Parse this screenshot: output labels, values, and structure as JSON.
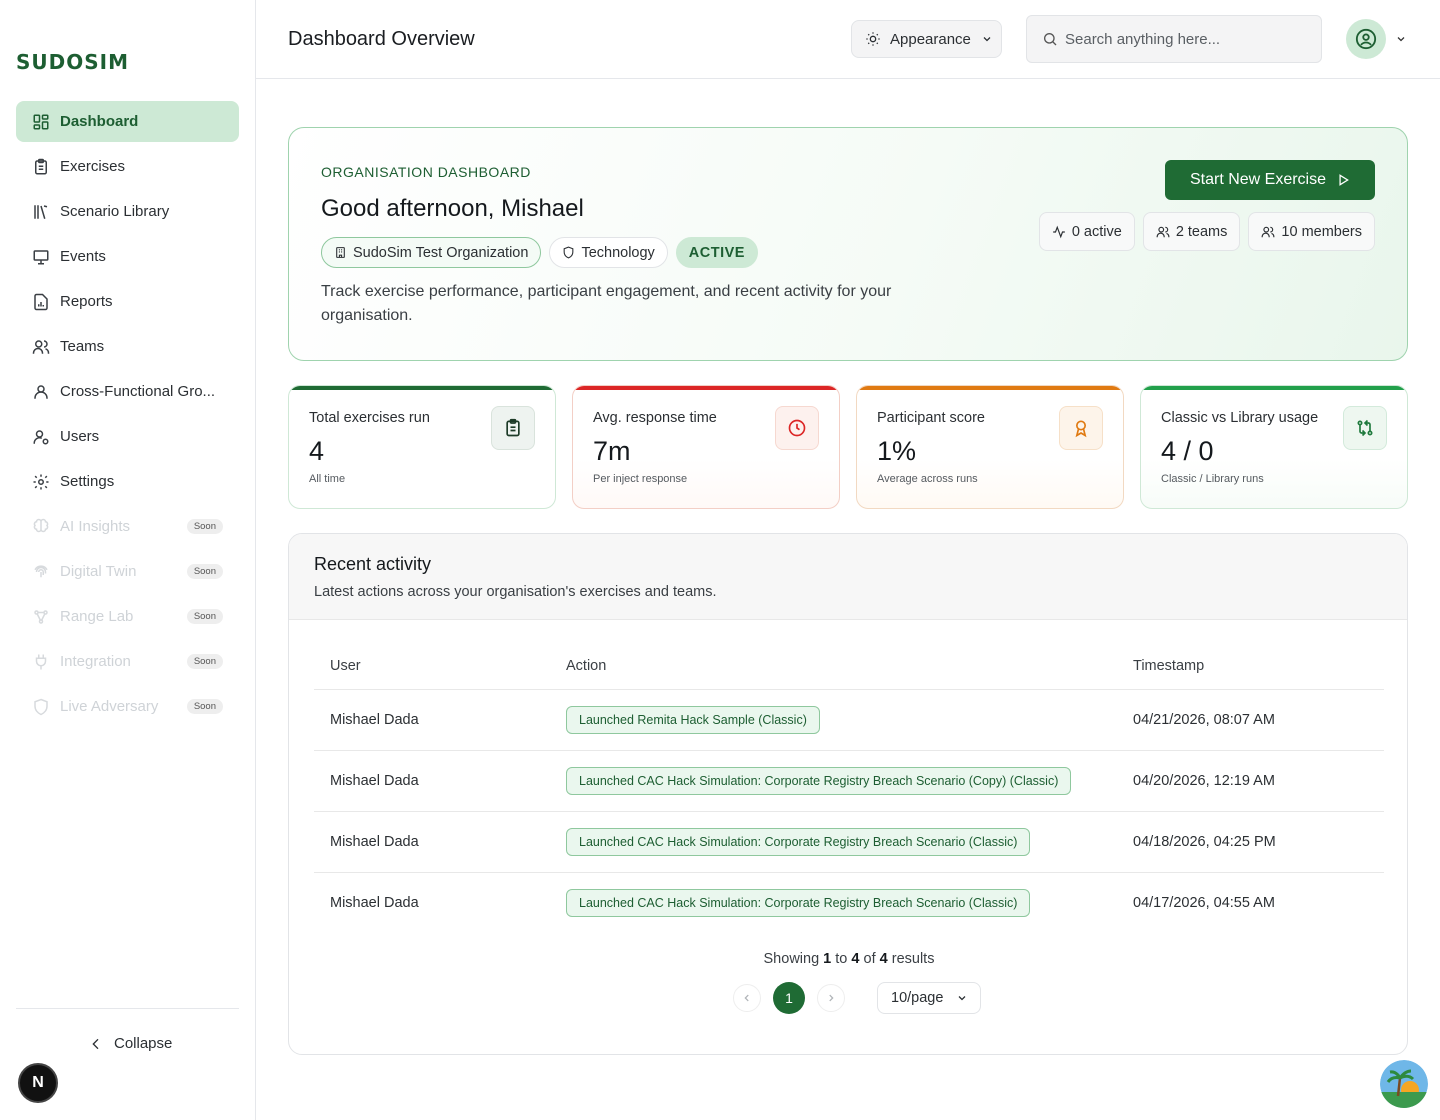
{
  "brand": {
    "logo_text": "SUDOSIM",
    "accent": "#1f6b34",
    "accent_light": "#cde9d5"
  },
  "sidebar": {
    "items": [
      {
        "label": "Dashboard",
        "icon": "layout-grid-icon",
        "active": true
      },
      {
        "label": "Exercises",
        "icon": "clipboard-icon"
      },
      {
        "label": "Scenario Library",
        "icon": "library-icon"
      },
      {
        "label": "Events",
        "icon": "presentation-icon"
      },
      {
        "label": "Reports",
        "icon": "file-chart-icon"
      },
      {
        "label": "Teams",
        "icon": "users-icon"
      },
      {
        "label": "Cross-Functional Gro...",
        "icon": "user-group-icon"
      },
      {
        "label": "Users",
        "icon": "user-cog-icon"
      },
      {
        "label": "Settings",
        "icon": "gear-icon"
      },
      {
        "label": "AI Insights",
        "icon": "brain-icon",
        "badge": "Soon"
      },
      {
        "label": "Digital Twin",
        "icon": "fingerprint-icon",
        "badge": "Soon"
      },
      {
        "label": "Range Lab",
        "icon": "network-icon",
        "badge": "Soon"
      },
      {
        "label": "Integration",
        "icon": "plug-icon",
        "badge": "Soon"
      },
      {
        "label": "Live Adversary",
        "icon": "shield-icon",
        "badge": "Soon"
      }
    ],
    "collapse_label": "Collapse",
    "bottom_badge": "N"
  },
  "header": {
    "title": "Dashboard Overview",
    "appearance_label": "Appearance",
    "search_placeholder": "Search anything here..."
  },
  "hero": {
    "eyebrow": "ORGANISATION DASHBOARD",
    "greeting": "Good afternoon, Mishael",
    "org_name": "SudoSim Test Organization",
    "industry": "Technology",
    "status": "ACTIVE",
    "description": "Track exercise performance, participant engagement, and recent activity for your organisation.",
    "cta_label": "Start New Exercise",
    "pills": {
      "active": "0 active",
      "teams": "2 teams",
      "members": "10 members"
    }
  },
  "metrics": [
    {
      "label": "Total exercises run",
      "value": "4",
      "sub": "All time",
      "accent": "#1f6b34"
    },
    {
      "label": "Avg. response time",
      "value": "7m",
      "sub": "Per inject response",
      "accent": "#dc2626"
    },
    {
      "label": "Participant score",
      "value": "1%",
      "sub": "Average across runs",
      "accent": "#e07a12"
    },
    {
      "label": "Classic vs Library usage",
      "value": "4 / 0",
      "sub": "Classic / Library runs",
      "accent": "#22a04b"
    }
  ],
  "activity": {
    "title": "Recent activity",
    "subtitle": "Latest actions across your organisation's exercises and teams.",
    "columns": {
      "user": "User",
      "action": "Action",
      "timestamp": "Timestamp"
    },
    "rows": [
      {
        "user": "Mishael Dada",
        "action": "Launched Remita Hack Sample (Classic)",
        "timestamp": "04/21/2026, 08:07 AM"
      },
      {
        "user": "Mishael Dada",
        "action": "Launched CAC Hack Simulation: Corporate Registry Breach Scenario (Copy) (Classic)",
        "timestamp": "04/20/2026, 12:19 AM"
      },
      {
        "user": "Mishael Dada",
        "action": "Launched CAC Hack Simulation: Corporate Registry Breach Scenario (Classic)",
        "timestamp": "04/18/2026, 04:25 PM"
      },
      {
        "user": "Mishael Dada",
        "action": "Launched CAC Hack Simulation: Corporate Registry Breach Scenario (Classic)",
        "timestamp": "04/17/2026, 04:55 AM"
      }
    ],
    "pagination": {
      "showing_prefix": "Showing",
      "from": "1",
      "to_word": "to",
      "to": "4",
      "of_word": "of",
      "total": "4",
      "results_word": "results",
      "current_page": "1",
      "per_page": "10/page"
    }
  }
}
